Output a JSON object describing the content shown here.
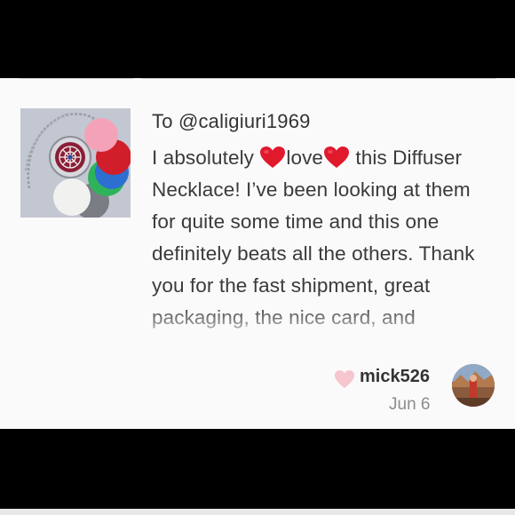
{
  "review": {
    "recipient": "To @caligiuri1969",
    "message": {
      "p1": "I absolutely ",
      "p2": "love",
      "p3": " this Diffuser Necklace! I’ve been looking at them for quite some time and this one definitely beats all the others. Thank you for the fast shipment, great packaging, the nice card, and"
    },
    "heart_icon": "red-heart-emoji",
    "username": "mick526",
    "date": "Jun 6",
    "like_icon": "heart-outline-icon"
  },
  "colors": {
    "background": "#000000",
    "card": "#fbfafb",
    "text": "#3a3a3a",
    "heart": "#e0192d",
    "like_heart": "#f6c6cf",
    "date": "#8c8c8c"
  }
}
